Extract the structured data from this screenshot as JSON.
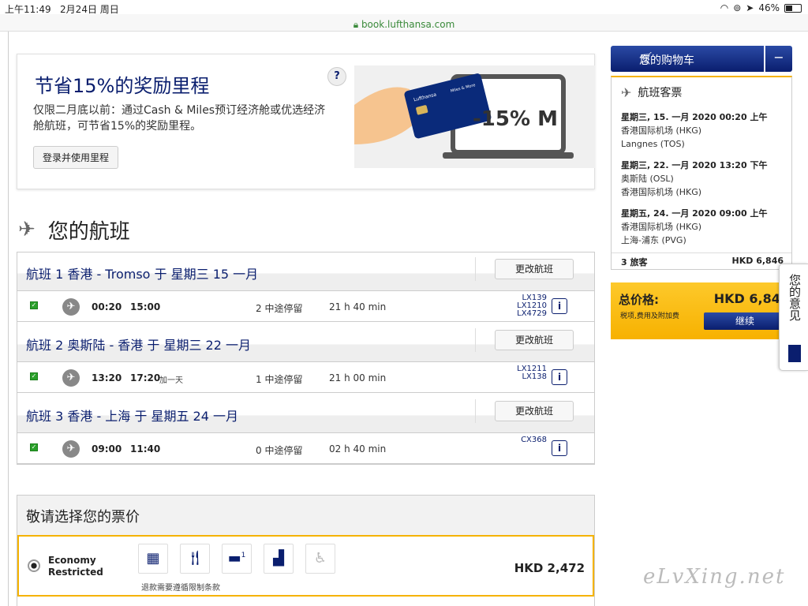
{
  "statusbar": {
    "time": "上午11:49",
    "date": "2月24日 周日",
    "battery": "46%",
    "battery_level": 0.46
  },
  "url": "book.lufthansa.com",
  "promo": {
    "title": "节省15%的奖励里程",
    "text": "仅限二月底以前：通过Cash & Miles预订经济舱或优选经济舱航班，可节省15%的奖励里程。",
    "button": "登录并使用里程",
    "help": "?",
    "art_label": "-15% M",
    "card_brand": "Lufthansa",
    "card_label": "Miles & More"
  },
  "section_title": "您的航班",
  "change_label": "更改航班",
  "flights": [
    {
      "title": "航班 1 香港 - Tromso 于 星期三 15 一月",
      "dep": "00:20",
      "arr": "15:00",
      "plus": "",
      "stops": "2 中途停留",
      "duration": "21 h 40 min",
      "numbers": [
        "LX139",
        "LX1210",
        "LX4729"
      ]
    },
    {
      "title": "航班 2 奥斯陆 - 香港 于 星期三 22 一月",
      "dep": "13:20",
      "arr": "17:20",
      "plus": "加一天",
      "stops": "1 中途停留",
      "duration": "21 h 00 min",
      "numbers": [
        "LX1211",
        "LX138"
      ]
    },
    {
      "title": "航班 3 香港 - 上海 于 星期五 24 一月",
      "dep": "09:00",
      "arr": "11:40",
      "plus": "",
      "stops": "0 中途停留",
      "duration": "02 h 40 min",
      "numbers": [
        "CX368"
      ]
    }
  ],
  "fares": {
    "title": "敬请选择您的票价",
    "selected": {
      "name_line1": "Economy",
      "name_line2": "Restricted",
      "note": "退款需要遵循限制条款",
      "price": "HKD 2,472",
      "baggage_count": "1"
    }
  },
  "cart": {
    "title": "您的购物车",
    "minimize": "−",
    "section": "航班客票",
    "segments": [
      {
        "when": "星期三, 15. 一月 2020 00:20 上午",
        "from": "香港国际机场 (HKG)",
        "to": "Langnes (TOS)"
      },
      {
        "when": "星期三, 22. 一月 2020 13:20 下午",
        "from": "奥斯陆 (OSL)",
        "to": "香港国际机场 (HKG)"
      },
      {
        "when": "星期五, 24. 一月 2020 09:00 上午",
        "from": "香港国际机场 (HKG)",
        "to": "上海-浦东 (PVG)"
      }
    ],
    "pax": "3 旅客",
    "pax_price": "HKD 6,846"
  },
  "total": {
    "label": "总价格:",
    "amount": "HKD 6,846",
    "sub": "税项,费用及附加费",
    "continue": "继续"
  },
  "feedback": "您的意见",
  "watermark": "eLvXing.net"
}
